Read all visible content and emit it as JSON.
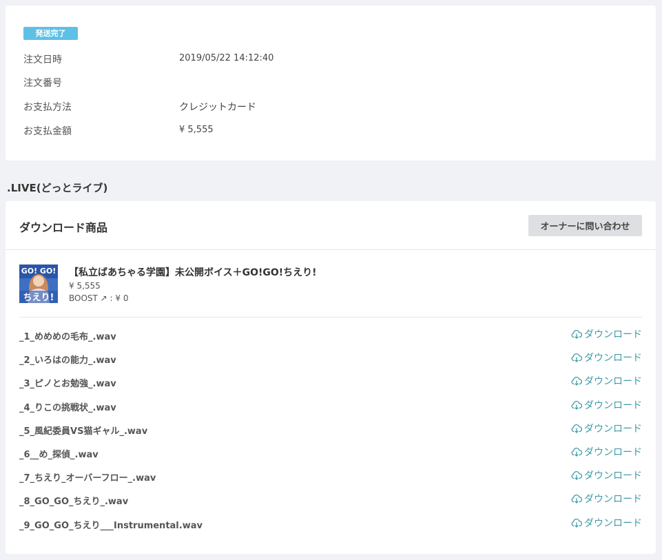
{
  "order": {
    "status_badge": "発送完了",
    "rows": [
      {
        "label": "注文日時",
        "value": "2019/05/22 14:12:40"
      },
      {
        "label": "注文番号",
        "value": ""
      },
      {
        "label": "お支払方法",
        "value": "クレジットカード"
      },
      {
        "label": "お支払金額",
        "value": "¥ 5,555"
      }
    ]
  },
  "shop": {
    "name": ".LIVE(どっとライブ)"
  },
  "downloads": {
    "section_title": "ダウンロード商品",
    "contact_button": "オーナーに問い合わせ",
    "product": {
      "title": "【私立ばあちゃる学園】未公開ボイス＋GO!GO!ちえり!",
      "price": "¥ 5,555",
      "boost": "BOOST ↗ : ¥ 0",
      "thumb_text_top": "GO! GO!",
      "thumb_text_bottom": "ちえり!"
    },
    "download_label": "ダウンロード",
    "files": [
      {
        "name": "_1_めめめの毛布_.wav"
      },
      {
        "name": "_2_いろはの能力_.wav"
      },
      {
        "name": "_3_ピノとお勉強_.wav"
      },
      {
        "name": "_4_りこの挑戦状_.wav"
      },
      {
        "name": "_5_風紀委員VS猫ギャル_.wav"
      },
      {
        "name": "_6__め_探偵_.wav"
      },
      {
        "name": "_7_ちえり_オーバーフロー_.wav"
      },
      {
        "name": "_8_GO_GO_ちえり_.wav"
      },
      {
        "name": "_9_GO_GO_ちえり___Instrumental.wav"
      }
    ]
  },
  "colors": {
    "badge": "#5fc0e6",
    "download_link": "#3e9aa6",
    "button_bg": "#dedfe3"
  }
}
